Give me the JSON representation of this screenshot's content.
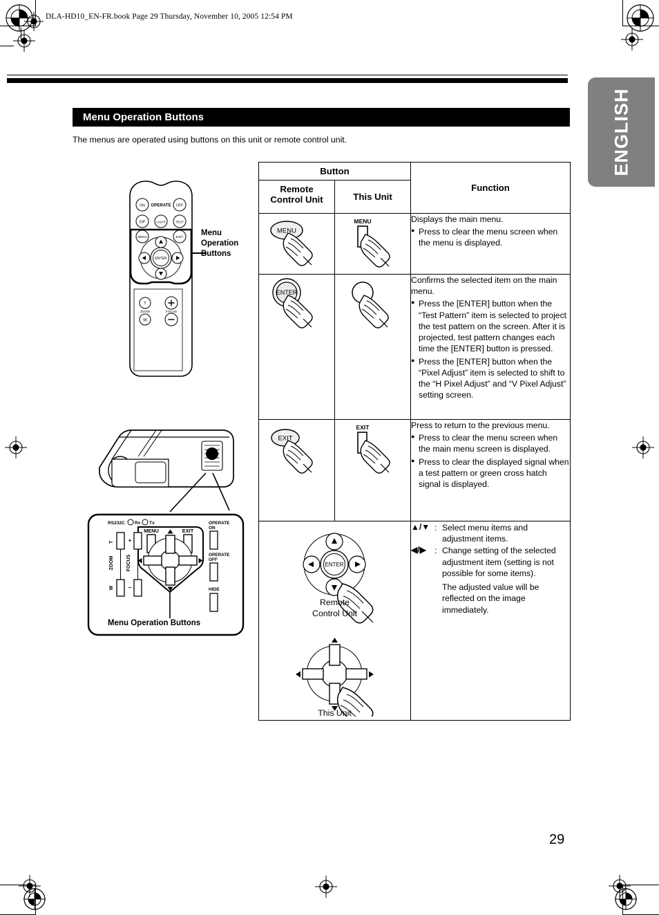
{
  "print_header": "DLA-HD10_EN-FR.book  Page 29  Thursday, November 10, 2005  12:54 PM",
  "language_tab": "ENGLISH",
  "page_number": "29",
  "section": {
    "title": "Menu Operation Buttons",
    "intro": "The menus are operated using buttons on this unit or remote control unit."
  },
  "table": {
    "header": {
      "button_group": "Button",
      "remote": "Remote\nControl Unit",
      "this_unit": "This Unit",
      "function": "Function"
    },
    "rows": [
      {
        "id": "menu",
        "remote_button_label": "MENU",
        "this_unit_button_label": "MENU",
        "function_lead": "Displays the main menu.",
        "function_bullets": [
          "Press to clear the menu screen when the menu is displayed."
        ]
      },
      {
        "id": "enter",
        "remote_button_label": "ENTER",
        "this_unit_button_label": "",
        "function_lead": "Confirms the selected item on the main menu.",
        "function_bullets": [
          "Press the [ENTER] button when the “Test Pattern” item is selected to project the test pattern on the screen. After it is projected, test pattern changes each time the [ENTER] button is pressed.",
          "Press the [ENTER] button when the “Pixel Adjust” item is selected to shift to the “H Pixel Adjust” and “V Pixel Adjust” setting screen."
        ]
      },
      {
        "id": "exit",
        "remote_button_label": "EXIT",
        "this_unit_button_label": "EXIT",
        "function_lead": "Press to return to the previous menu.",
        "function_bullets": [
          "Press to clear the menu screen when the main menu screen is displayed.",
          "Press to clear the displayed signal when a test pattern or green cross hatch signal is displayed."
        ]
      },
      {
        "id": "arrows",
        "remote_caption": "Remote\nControl Unit",
        "this_unit_caption": "This Unit",
        "remote_enter_label": "ENTER",
        "function_items": [
          {
            "keys": "▲/▼",
            "colon": ":",
            "text": "Select menu items and adjustment items."
          },
          {
            "keys": "◀/▶",
            "colon": ":",
            "text": "Change setting of the selected adjustment item (setting is not possible for some items)."
          }
        ],
        "function_note": "The adjusted value will be reflected on the image immediately."
      }
    ]
  },
  "remote_illustration": {
    "callout": "Menu\nOperation\nButtons",
    "callout_line1": "Menu",
    "callout_line2": "Operation",
    "callout_line3": "Buttons",
    "buttons": {
      "on": "ON",
      "operate": "OPERATE",
      "off": "OFF",
      "dip": "DIP",
      "light": "LIGHT",
      "test": "TEST",
      "menu": "MENU",
      "exit": "EXIT",
      "enter": "ENTER",
      "zoom_t": "T",
      "zoom_w": "W",
      "zoom_label": "ZOOM",
      "focus_plus": "+",
      "focus_minus": "−",
      "focus_label": "FOCUS"
    }
  },
  "control_panel": {
    "caption": "Menu Operation Buttons",
    "labels": {
      "rs232c": "RS232C",
      "rx": "Rx",
      "tx": "Tx",
      "menu": "MENU",
      "exit": "EXIT",
      "operate_on_1": "OPERATE",
      "operate_on_2": "ON",
      "operate_off_1": "OPERATE",
      "operate_off_2": "OFF",
      "hide": "HIDE",
      "zoom": "ZOOM",
      "zoom_t": "T",
      "zoom_w": "W",
      "focus": "FOCUS",
      "focus_plus": "+",
      "focus_minus": "−"
    }
  },
  "colors": {
    "title_bar_bg": "#000000",
    "title_bar_text": "#ffffff",
    "lang_tab_bg": "#808080",
    "lang_tab_text": "#ffffff",
    "rule": "#000000",
    "page_bg": "#ffffff"
  }
}
